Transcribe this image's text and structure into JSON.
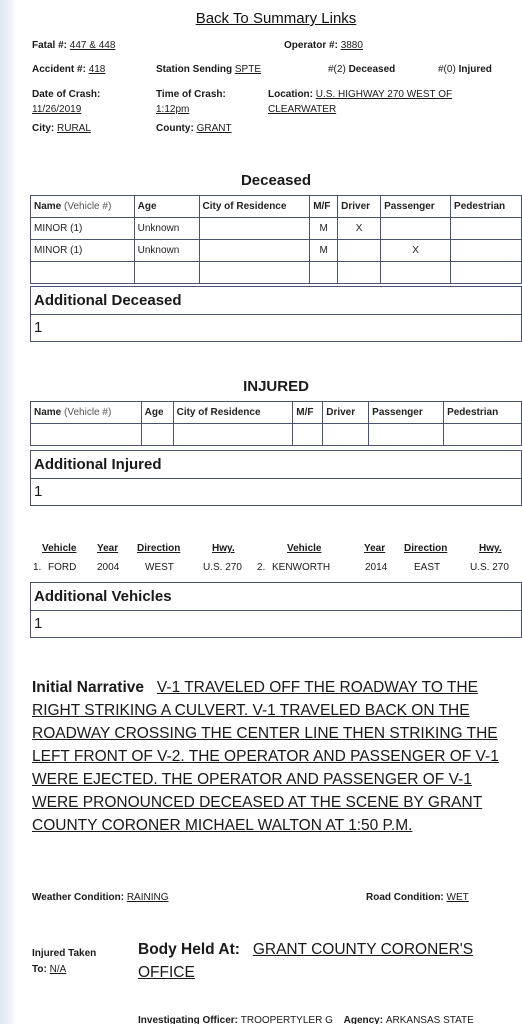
{
  "back_link": "Back To Summary Links",
  "header": {
    "fatal_label": "Fatal #:",
    "fatal_value": "447 & 448",
    "operator_label": "Operator #:",
    "operator_value": "3880",
    "accident_label": "Accident #:",
    "accident_value": "418",
    "station_label": "Station Sending",
    "station_value": "SPTE",
    "deceased_count": "#(2)",
    "deceased_label": "Deceased",
    "injured_count": "#(0)",
    "injured_label": "Injured",
    "date_label": "Date of Crash:",
    "date_value": "11/26/2019",
    "time_label": "Time of Crash:",
    "time_value": "1:12pm",
    "location_label": "Location:",
    "location_value_1": "U.S. HIGHWAY 270 WEST OF",
    "location_value_2": "CLEARWATER",
    "city_label": "City:",
    "city_value": "RURAL",
    "county_label": "County:",
    "county_value": "GRANT"
  },
  "deceased": {
    "title": "Deceased",
    "columns": {
      "name": "Name",
      "vehicle": "(Vehicle #)",
      "age": "Age",
      "city": "City of Residence",
      "mf": "M/F",
      "driver": "Driver",
      "passenger": "Passenger",
      "pedestrian": "Pedestrian"
    },
    "rows": [
      {
        "name": "MINOR (1)",
        "age": "Unknown",
        "city": "",
        "mf": "M",
        "driver": "X",
        "passenger": "",
        "pedestrian": ""
      },
      {
        "name": "MINOR (1)",
        "age": "Unknown",
        "city": "",
        "mf": "M",
        "driver": "",
        "passenger": "X",
        "pedestrian": ""
      },
      {
        "name": "",
        "age": "",
        "city": "",
        "mf": "",
        "driver": "",
        "passenger": "",
        "pedestrian": ""
      }
    ],
    "additional_title": "Additional Deceased",
    "additional_value": "1"
  },
  "injured": {
    "title": "INJURED",
    "columns": {
      "name": "Name",
      "vehicle": "(Vehicle #)",
      "age": "Age",
      "city": "City of Residence",
      "mf": "M/F",
      "driver": "Driver",
      "passenger": "Passenger",
      "pedestrian": "Pedestrian"
    },
    "additional_title": "Additional Injured",
    "additional_value": "1"
  },
  "vehicles": {
    "headers": [
      "Vehicle",
      "Year",
      "Direction",
      "Hwy.",
      "Vehicle",
      "Year",
      "Direction",
      "Hwy."
    ],
    "v1": {
      "num": "1.",
      "make": "FORD",
      "year": "2004",
      "direction": "WEST",
      "hwy": "U.S. 270"
    },
    "v2": {
      "num": "2.",
      "make": "KENWORTH",
      "year": "2014",
      "direction": "EAST",
      "hwy": "U.S. 270"
    },
    "additional_title": "Additional Vehicles",
    "additional_value": "1"
  },
  "narrative": {
    "label": "Initial Narrative",
    "text": "V-1 TRAVELED OFF THE ROADWAY TO THE RIGHT STRIKING A CULVERT. V-1 TRAVELED BACK ON THE ROADWAY CROSSING THE CENTER LINE THEN STRIKING THE LEFT FRONT OF V-2. THE OPERATOR AND PASSENGER OF V-1 WERE EJECTED. THE OPERATOR AND PASSENGER OF V-1 WERE PRONOUNCED DECEASED AT THE SCENE BY GRANT COUNTY CORONER MICHAEL WALTON AT 1:50 P.M."
  },
  "conditions": {
    "weather_label": "Weather Condition:",
    "weather_value": "RAINING",
    "road_label": "Road Condition:",
    "road_value": "WET"
  },
  "injured_taken": {
    "label_1": "Injured Taken",
    "label_2": "To:",
    "value": "N/A"
  },
  "body_held": {
    "label": "Body Held At:",
    "value_1": "GRANT COUNTY CORONER'S",
    "value_2": "OFFICE"
  },
  "officer": {
    "label": "Investigating Officer:",
    "value": "TROOPERTYLER G",
    "agency_label": "Agency:",
    "agency_value": "ARKANSAS STATE"
  }
}
